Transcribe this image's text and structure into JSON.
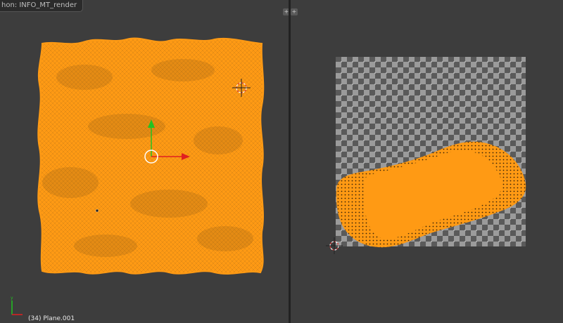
{
  "tooltip": {
    "text": "hon: INFO_MT_render"
  },
  "left_viewport": {
    "status_text": "(34) Plane.001"
  },
  "corner_widgets": {
    "left_symbol": "+",
    "right_symbol": "+"
  },
  "colors": {
    "viewport_bg": "#3d3d3d",
    "mesh_orange": "#ff9a14",
    "mesh_wire": "#6e4a14",
    "axis_x": "#e02020",
    "axis_y": "#22c322",
    "cursor_red": "#d33d3d"
  },
  "icons": [
    "3d-cursor-icon",
    "transform-manipulator-icon",
    "axis-gizmo-icon",
    "uv-2d-cursor-icon",
    "split-corner-icon"
  ]
}
